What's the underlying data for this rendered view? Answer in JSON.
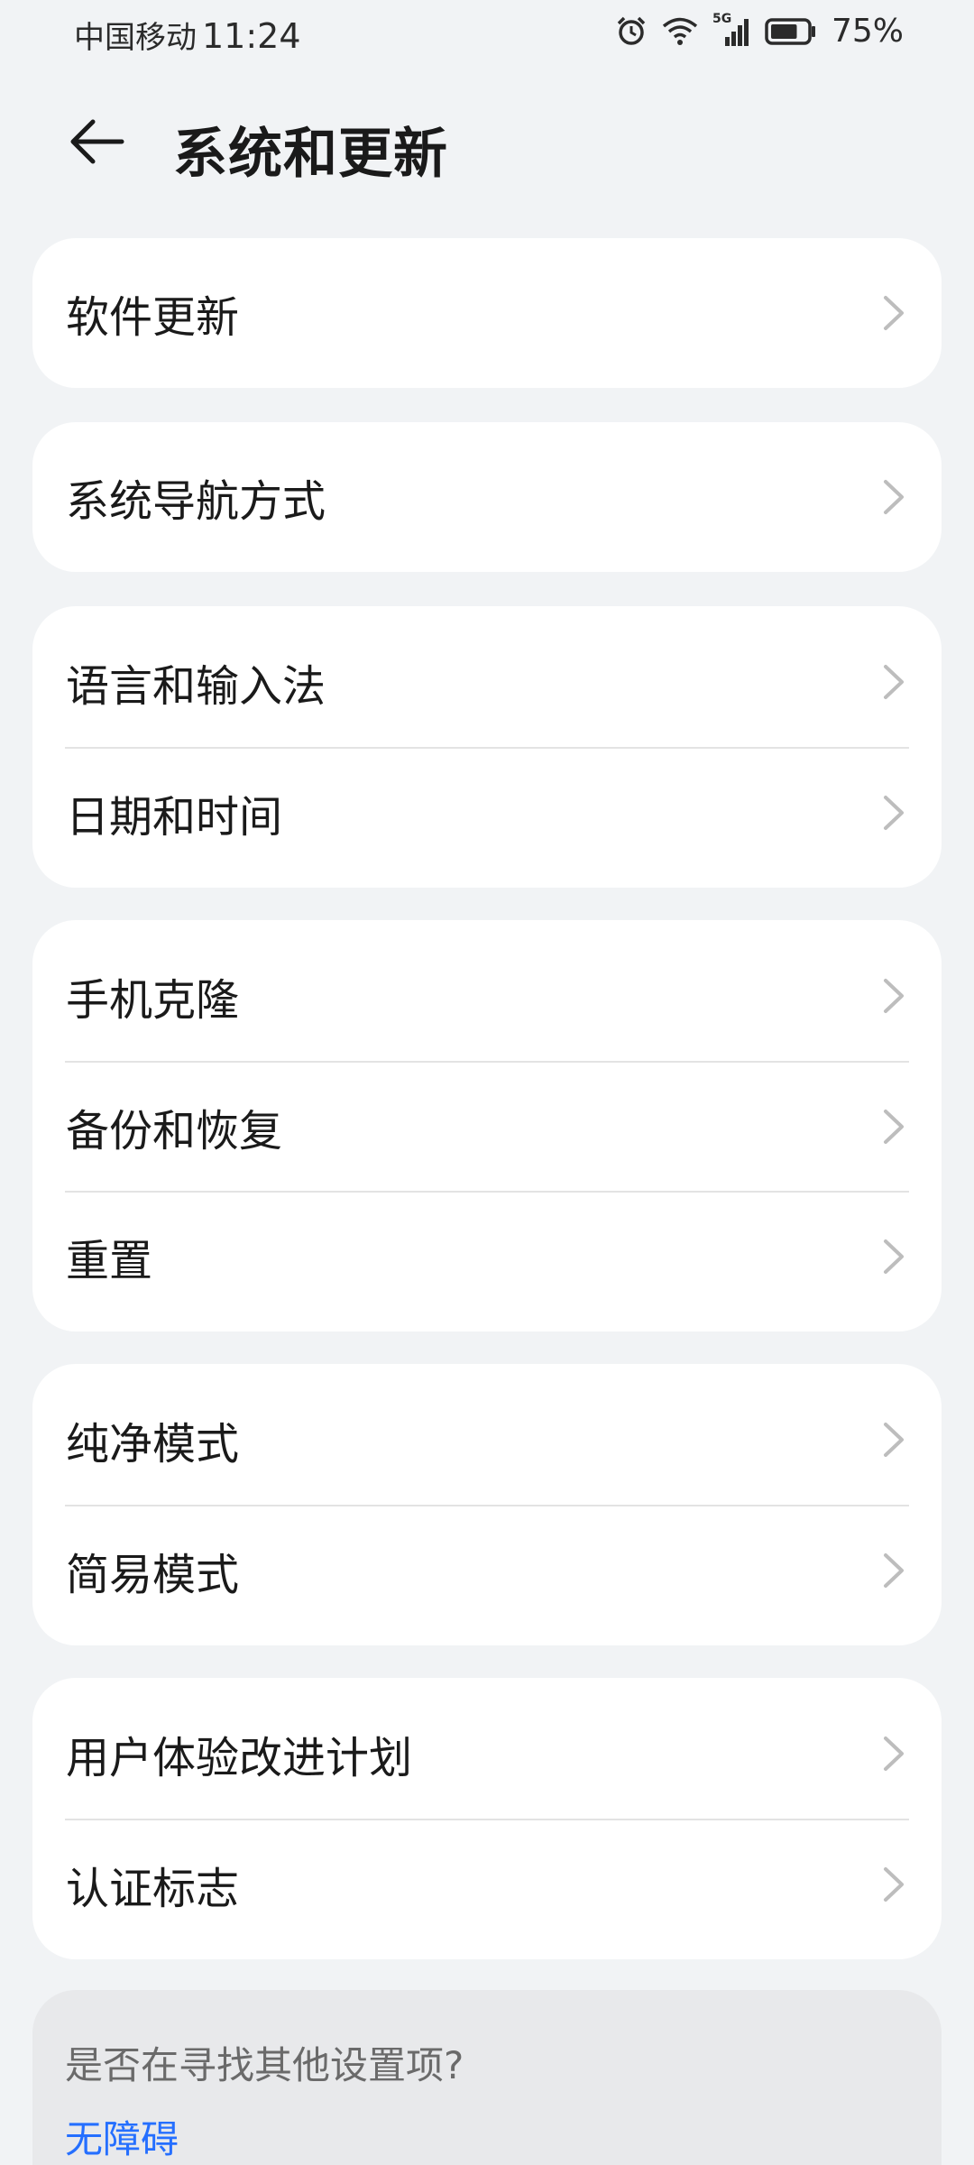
{
  "status_bar": {
    "carrier": "中国移动",
    "time": "11:24",
    "network": "5G",
    "battery_percent": "75%",
    "battery_level": 0.75,
    "icons": [
      "alarm-icon",
      "wifi-icon",
      "cellular-signal-icon",
      "battery-icon"
    ]
  },
  "header": {
    "back_icon": "back-arrow-icon",
    "title": "系统和更新"
  },
  "groups": [
    {
      "items": [
        {
          "label": "软件更新"
        }
      ]
    },
    {
      "items": [
        {
          "label": "系统导航方式"
        }
      ]
    },
    {
      "items": [
        {
          "label": "语言和输入法"
        },
        {
          "label": "日期和时间"
        }
      ]
    },
    {
      "items": [
        {
          "label": "手机克隆"
        },
        {
          "label": "备份和恢复"
        },
        {
          "label": "重置"
        }
      ]
    },
    {
      "items": [
        {
          "label": "纯净模式"
        },
        {
          "label": "简易模式"
        }
      ]
    },
    {
      "items": [
        {
          "label": "用户体验改进计划"
        },
        {
          "label": "认证标志"
        }
      ]
    }
  ],
  "suggestion": {
    "question": "是否在寻找其他设置项?",
    "link": "无障碍"
  },
  "colors": {
    "background": "#f1f3f5",
    "card": "#ffffff",
    "link": "#256fff",
    "chevron": "#bdbdbd"
  }
}
